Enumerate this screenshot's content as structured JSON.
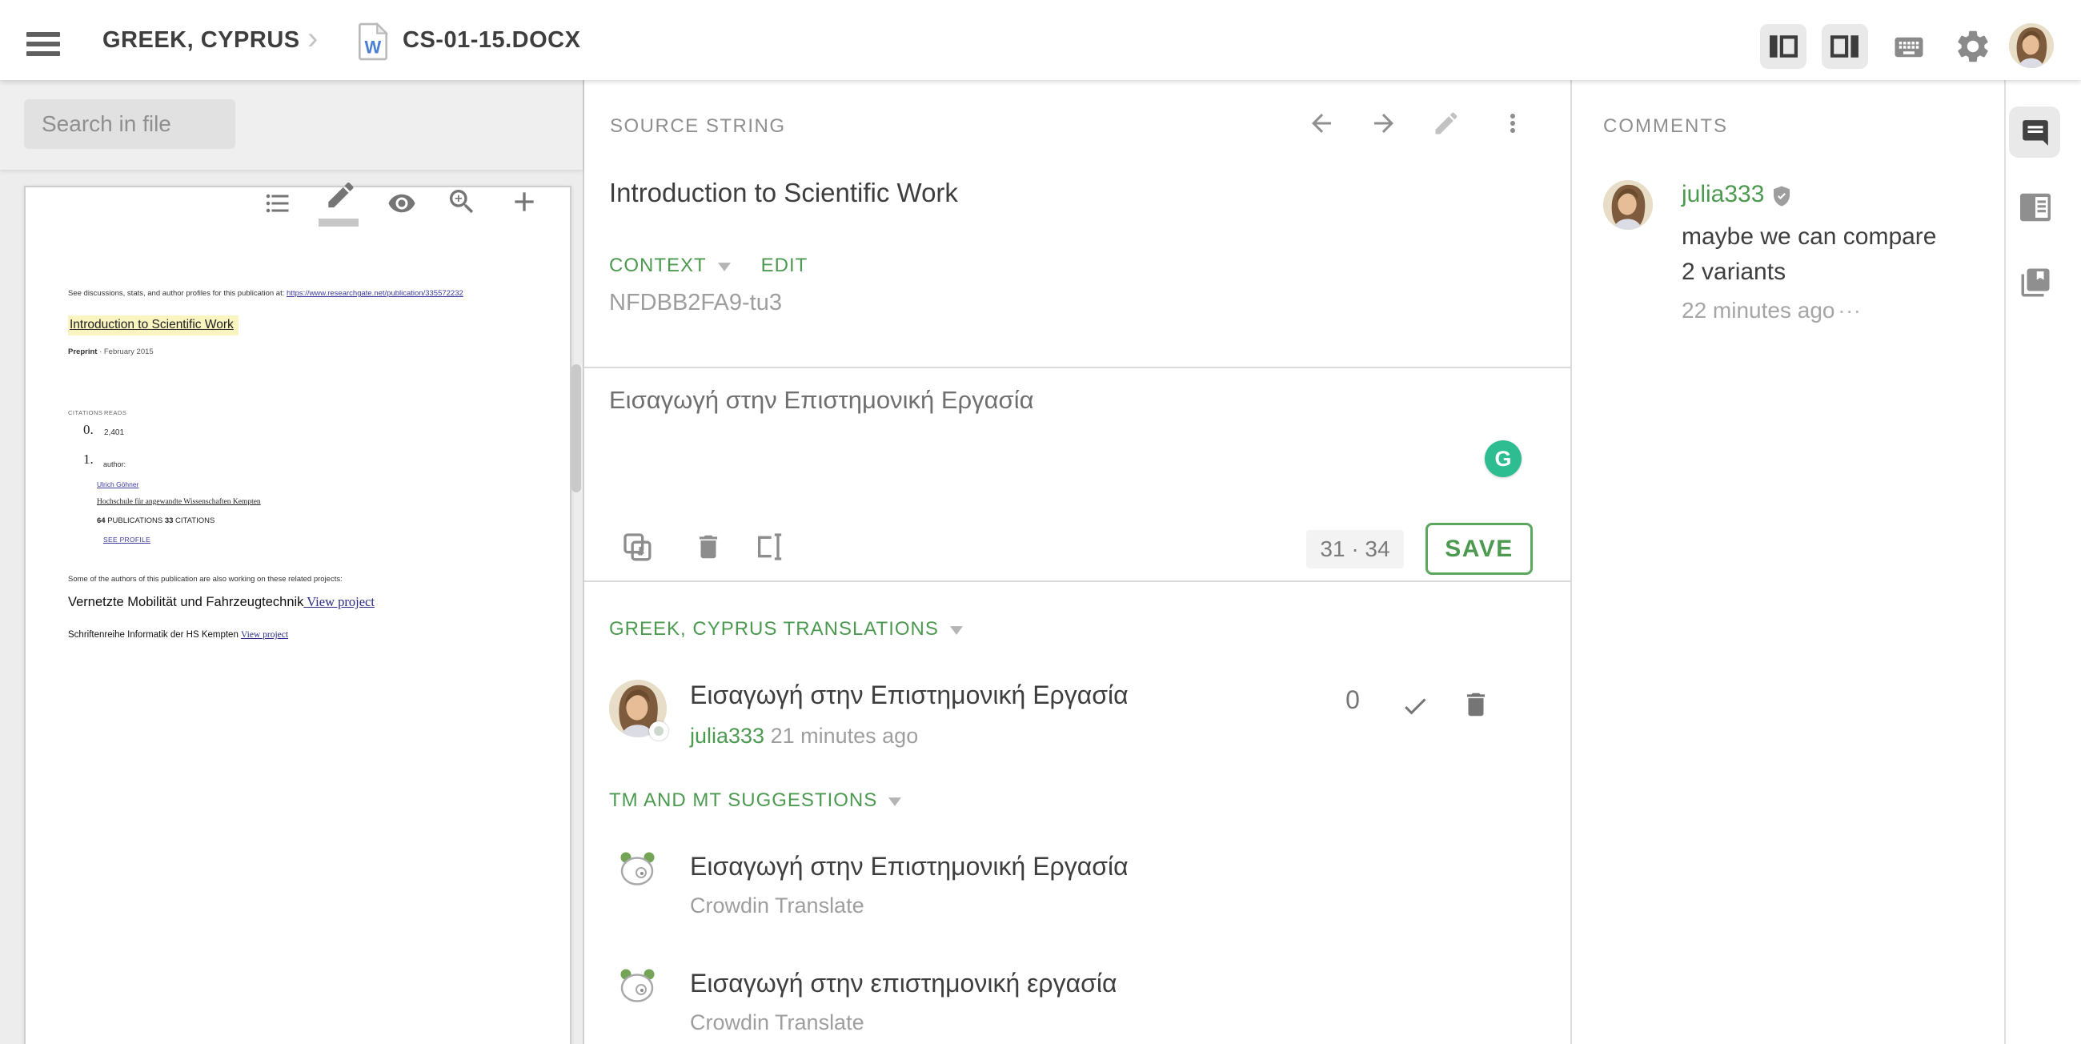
{
  "topbar": {
    "project_label": "GREEK, CYPRUS",
    "breadcrumb_separator": "›",
    "file_name": "CS-01-15.DOCX",
    "word_icon_letter": "W"
  },
  "left_panel": {
    "search_placeholder": "Search in file",
    "document": {
      "preface_text": "See discussions, stats, and author profiles for this publication at: ",
      "preface_link": "https://www.researchgate.net/publication/335572232",
      "title": "Introduction to Scientific Work",
      "meta_bold": "Preprint",
      "meta_rest": " · February 2015",
      "stats_citations_label": "CITATIONS",
      "stats_reads_label": "READS",
      "citations_value": "0.",
      "reads_value": "2,401",
      "author_index": "1.",
      "author_label": "author:",
      "author_name": "Ulrich Göhner",
      "author_affiliation": "Hochschule für angewandte Wissenschaften Kempten",
      "pubs_count": "64",
      "pubs_label": " PUBLICATIONS ",
      "citations_count": "33",
      "citations_label": " CITATIONS",
      "see_profile": "SEE PROFILE",
      "related_note": "Some of the authors of this publication are also working on these related projects:",
      "project1_title": "Vernetzte Mobilität und Fahrzeugtechnik",
      "project1_link": " View project",
      "project2_title": "Schriftenreihe Informatik der HS Kempten ",
      "project2_link": "View project"
    }
  },
  "editor": {
    "source_header": "SOURCE STRING",
    "source_text": "Introduction to Scientific Work",
    "context_label": "CONTEXT",
    "edit_label": "EDIT",
    "context_value": "NFDBB2FA9-tu3",
    "translation_text": "Εισαγωγή στην Επιστημονική Εργασία",
    "char_counter": "31 · 34",
    "save_label": "SAVE",
    "grammarly_letter": "G",
    "translations_header": "GREEK, CYPRUS TRANSLATIONS",
    "translation_rows": [
      {
        "text": "Εισαγωγή στην Επιστημονική Εργασία",
        "author": "julia333",
        "time": "21 minutes ago",
        "votes": "0"
      }
    ],
    "suggestions_header": "TM AND MT SUGGESTIONS",
    "suggestions": [
      {
        "text": "Εισαγωγή στην Επιστημονική Εργασία",
        "source": "Crowdin Translate"
      },
      {
        "text": "Εισαγωγή στην επιστημονική εργασία",
        "source": "Crowdin Translate"
      }
    ]
  },
  "comments": {
    "header": "COMMENTS",
    "items": [
      {
        "author": "julia333",
        "text": "maybe we can compare 2 variants",
        "time": "22 minutes ago",
        "more_label": "..."
      }
    ]
  },
  "colors": {
    "accent_green": "#4c9a50",
    "save_border": "#5ba75f",
    "grammarly_green": "#2dbd90",
    "link_blue": "#3b3b9e",
    "word_blue": "#4a7fd4"
  }
}
